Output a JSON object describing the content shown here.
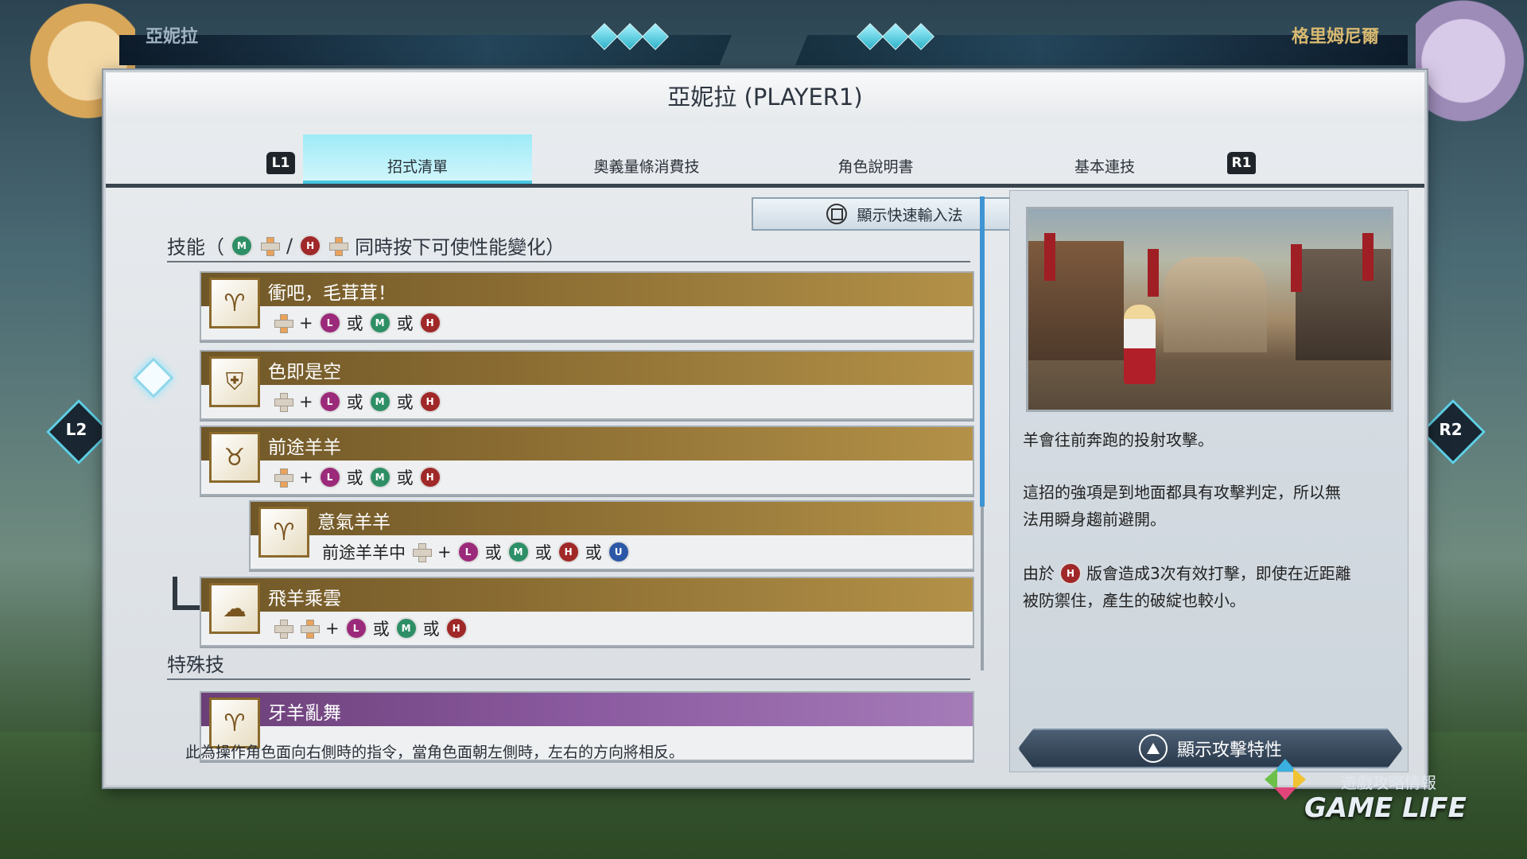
{
  "hud": {
    "p1_name": "亞妮拉",
    "p2_name": "格里姆尼爾"
  },
  "panel": {
    "title": "亞妮拉 (PLAYER1)",
    "left_shoulder": "L1",
    "right_shoulder": "R1",
    "tabs": [
      "招式清單",
      "奧義量條消費技",
      "角色說明書",
      "基本連技"
    ],
    "active_tab": 0
  },
  "quick_input": {
    "label": "顯示快速輸入法"
  },
  "skills_header": {
    "title": "技能（",
    "separator": "/",
    "suffix": "同時按下可使性能變化）"
  },
  "special_header": {
    "title": "特殊技"
  },
  "or_text": "或",
  "plus_text": "+",
  "moves": [
    {
      "name": "衝吧，毛茸茸！",
      "icon": "sheep-horn-icon",
      "prefix": ""
    },
    {
      "name": "色即是空",
      "icon": "shield-claw-icon",
      "prefix": ""
    },
    {
      "name": "前途羊羊",
      "icon": "sheep-run-icon",
      "prefix": ""
    },
    {
      "name": "意氣羊羊",
      "icon": "sheep-spin-icon",
      "prefix": "前途羊羊中"
    },
    {
      "name": "飛羊乘雲",
      "icon": "sheep-fly-icon",
      "prefix": ""
    }
  ],
  "special_moves": [
    {
      "name": "牙羊亂舞",
      "icon": "sheep-dance-icon"
    }
  ],
  "footnote": "此為操作角色面向右側時的指令，當角色面朝左側時，左右的方向將相反。",
  "description": {
    "p1": "羊會往前奔跑的投射攻擊。",
    "p2_line1": "這招的強項是到地面都具有攻擊判定，所以無",
    "p2_line2": "法用瞬身趨前避開。",
    "p3_prefix": "由於",
    "p3_line1_rest": "版會造成3次有效打擊，即使在近距離",
    "p3_line2": "被防禦住，產生的破綻也較小。"
  },
  "attr_button": {
    "label": "顯示攻擊特性"
  },
  "side_buttons": {
    "left": "L2",
    "right": "R2"
  },
  "watermark": {
    "main": "GAME LIFE",
    "sub": "遊戲攻略情報"
  },
  "colors": {
    "tab_active": "#9eeaf7",
    "move_bar": "#8a6c32",
    "special_bar": "#8b5aa0",
    "btn_L": "#9b2a7a",
    "btn_M": "#2e8f66",
    "btn_H": "#a02828",
    "btn_U": "#2b57a6"
  }
}
